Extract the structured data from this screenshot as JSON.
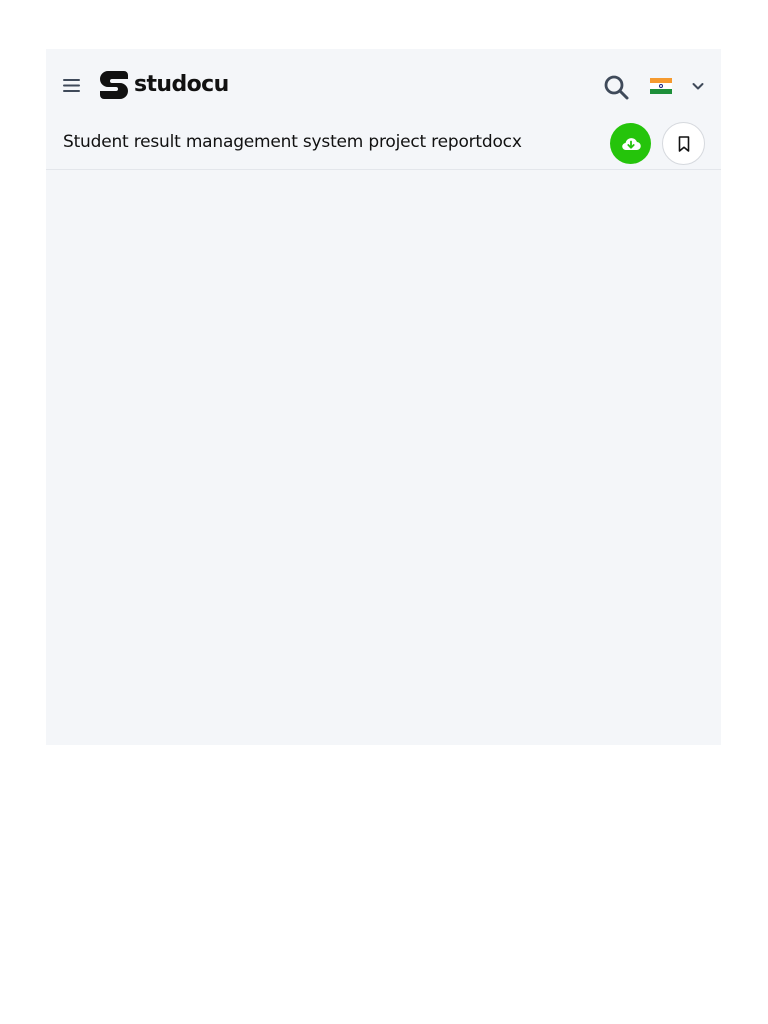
{
  "header": {
    "brand": "studocu",
    "menu_icon": "hamburger-menu-icon",
    "search_icon": "search-icon",
    "language": {
      "selected_flag": "india-flag-icon",
      "chevron": "chevron-down-icon"
    }
  },
  "document": {
    "title": "Student result management system project reportdocx",
    "download_icon": "cloud-download-icon",
    "bookmark_icon": "bookmark-icon"
  },
  "colors": {
    "accent_green": "#25c40b",
    "frame_background": "#f4f6f9",
    "text": "#111111",
    "icon_gray": "#3f4a5a"
  }
}
